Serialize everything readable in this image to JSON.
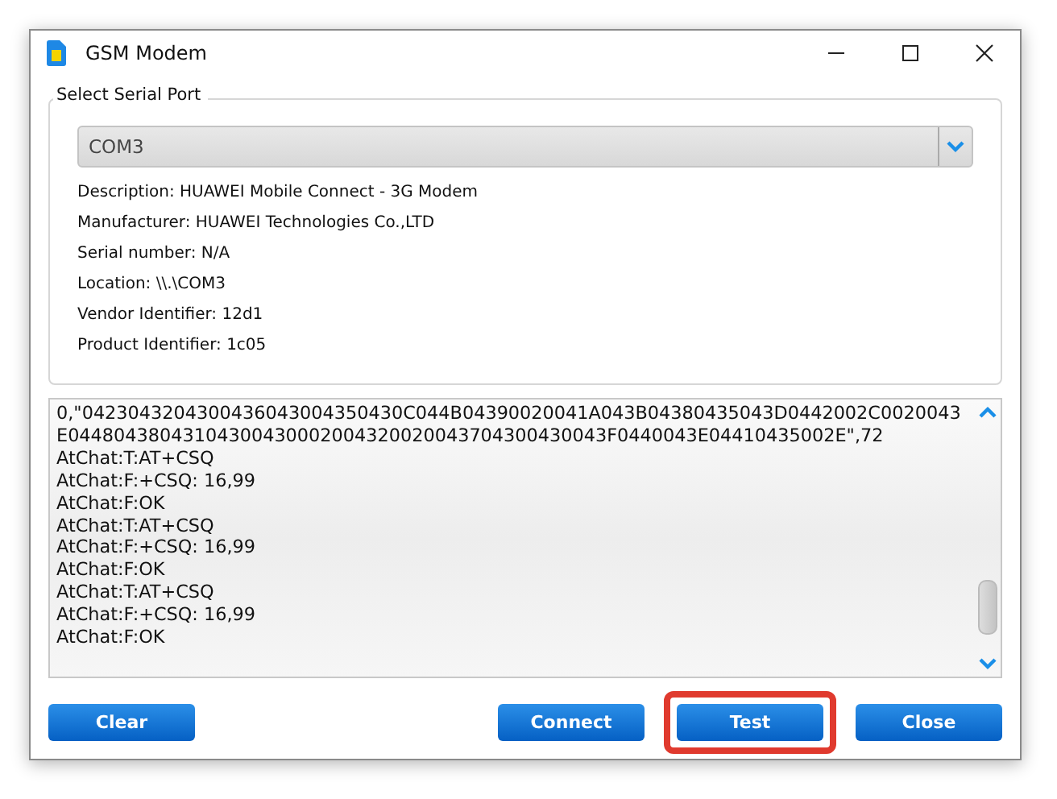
{
  "window": {
    "title": "GSM Modem"
  },
  "serial_port": {
    "label": "Select Serial Port",
    "selected_port": "COM3",
    "details": [
      "Description: HUAWEI Mobile Connect - 3G Modem",
      "Manufacturer: HUAWEI Technologies Co.,LTD",
      "Serial number: N/A",
      "Location: \\\\.\\COM3",
      "Vendor Identifier: 12d1",
      "Product Identifier: 1c05"
    ]
  },
  "log": [
    "0,\"0423043204300436043004350430C044B04390020041A043B04380435043D0442002C0020043E04480438043104300430002004320020043704300430043F0440043E04410435002E\",72",
    "AtChat:T:AT+CSQ",
    "AtChat:F:+CSQ: 16,99",
    "AtChat:F:OK",
    "AtChat:T:AT+CSQ",
    "AtChat:F:+CSQ: 16,99",
    "AtChat:F:OK",
    "AtChat:T:AT+CSQ",
    "AtChat:F:+CSQ: 16,99",
    "AtChat:F:OK"
  ],
  "buttons": [
    {
      "label": "Clear",
      "highlighted": false
    },
    {
      "label": "Connect",
      "highlighted": false
    },
    {
      "label": "Test",
      "highlighted": true
    },
    {
      "label": "Close",
      "highlighted": false
    }
  ]
}
